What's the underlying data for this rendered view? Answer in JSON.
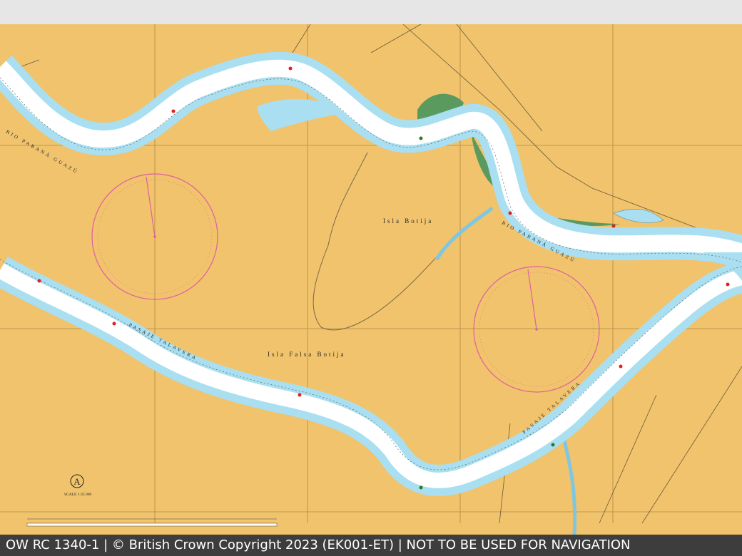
{
  "footer": {
    "caption": "OW RC 1340-1 | © British Crown Copyright 2023 (EK001-ET) | NOT TO BE USED FOR NAVIGATION"
  },
  "map": {
    "islands": {
      "isla_botija": "Isla Botija",
      "isla_falsa_botija": "Isla Falsa Botija"
    },
    "channels": {
      "rio_upper": "RIO PARANÁ GUAZÚ",
      "rio_right": "RIO PARANÁ GUAZÚ",
      "pasaje_left": "PASAJE TALAVERA",
      "pasaje_right": "PASAJE TALAVERA"
    },
    "panel_letter": "A",
    "scale": "SCALE 1:35 000",
    "compass_rose_1": "compass-rose",
    "compass_rose_2": "compass-rose"
  },
  "colors": {
    "land": "#f0c36c",
    "deep_water": "#ffffff",
    "shallow_water": "#a9dff0",
    "marsh": "#5b9a5f",
    "compass": "#e060a0",
    "grid": "#b08a46"
  }
}
